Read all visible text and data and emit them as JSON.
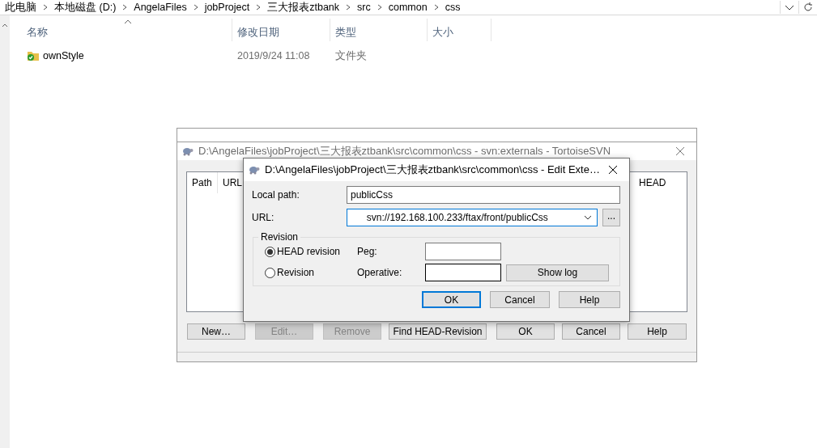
{
  "explorer": {
    "breadcrumb": [
      "此电脑",
      "本地磁盘 (D:)",
      "AngelaFiles",
      "jobProject",
      "三大报表ztbank",
      "src",
      "common",
      "css"
    ],
    "columns": [
      {
        "label": "名称",
        "sorted": true
      },
      {
        "label": "修改日期",
        "sorted": false
      },
      {
        "label": "类型",
        "sorted": false
      },
      {
        "label": "大小",
        "sorted": false
      }
    ],
    "rows": [
      {
        "name": "ownStyle",
        "date": "2019/9/24 11:08",
        "type": "文件夹"
      }
    ]
  },
  "externals_window": {
    "title": "D:\\AngelaFiles\\jobProject\\三大报表ztbank\\src\\common\\css - svn:externals - TortoiseSVN",
    "columns": [
      "Path",
      "URL",
      "HEAD"
    ],
    "buttons": [
      {
        "label": "New…",
        "disabled": false
      },
      {
        "label": "Edit…",
        "disabled": true
      },
      {
        "label": "Remove",
        "disabled": true
      },
      {
        "label": "Find HEAD-Revision",
        "disabled": false
      },
      {
        "label": "OK",
        "disabled": false
      },
      {
        "label": "Cancel",
        "disabled": false
      },
      {
        "label": "Help",
        "disabled": false
      }
    ]
  },
  "dialog": {
    "title": "D:\\AngelaFiles\\jobProject\\三大报表ztbank\\src\\common\\css - Edit Exte…",
    "local_path": {
      "label": "Local path:",
      "value": "publicCss"
    },
    "url": {
      "label": "URL:",
      "value": "svn://192.168.100.233/ftax/front/publicCss",
      "focused": true
    },
    "browse_button": "...",
    "revision": {
      "title": "Revision",
      "options": [
        {
          "label": "HEAD revision",
          "selected": true
        },
        {
          "label": "Revision",
          "selected": false
        }
      ],
      "peg_label": "Peg:",
      "operative_label": "Operative:",
      "show_log": "Show log"
    },
    "buttons": [
      {
        "label": "OK",
        "default": true
      },
      {
        "label": "Cancel",
        "default": false
      },
      {
        "label": "Help",
        "default": false
      }
    ]
  }
}
